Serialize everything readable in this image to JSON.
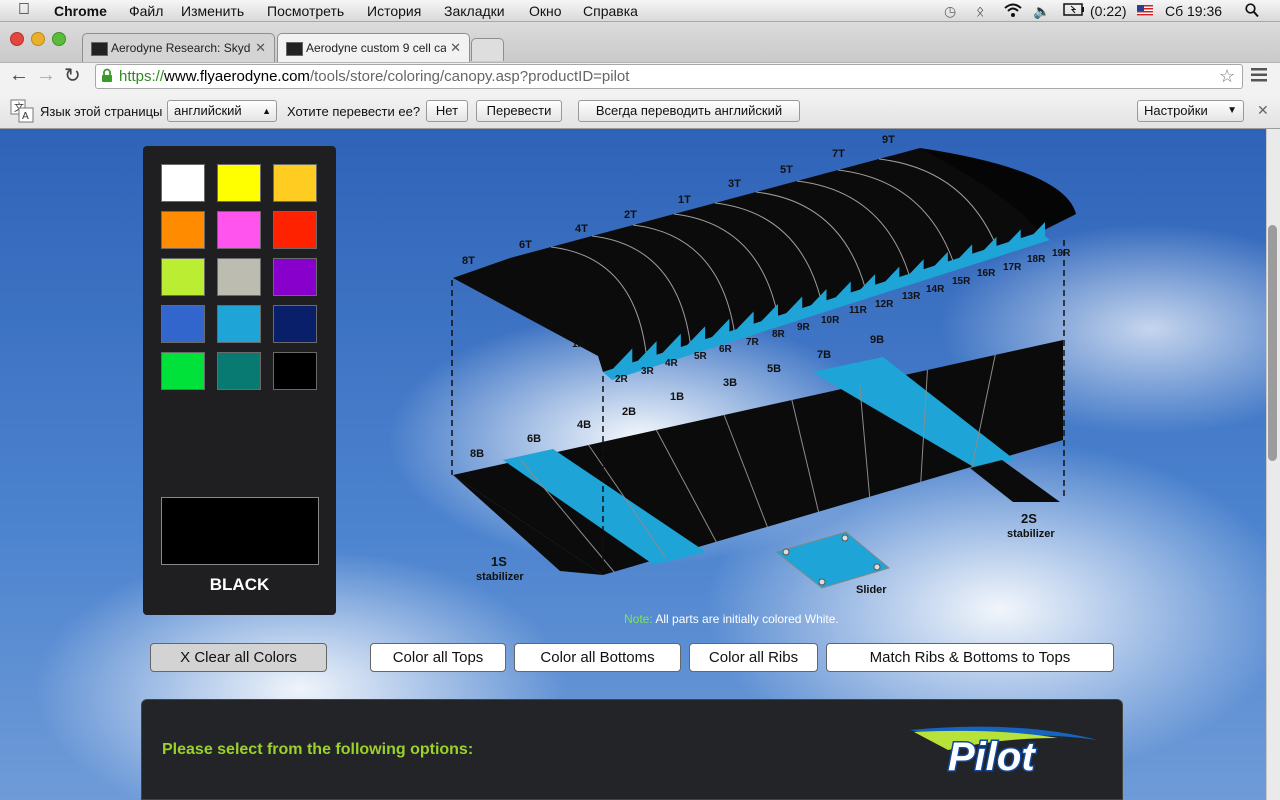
{
  "menubar": {
    "app": "Chrome",
    "items": [
      "Файл",
      "Изменить",
      "Посмотреть",
      "История",
      "Закладки",
      "Окно",
      "Справка"
    ],
    "battery": "(0:22)",
    "clock": "Сб 19:36"
  },
  "tabs": [
    {
      "title": "Aerodyne Research: Skydiv"
    },
    {
      "title": "Aerodyne custom 9 cell ca"
    }
  ],
  "address": {
    "scheme": "https://",
    "host": "www.flyaerodyne.com",
    "path": "/tools/store/coloring/canopy.asp?productID=pilot"
  },
  "translate": {
    "label": "Язык этой страницы",
    "language": "английский",
    "question": "Хотите перевести ее?",
    "no": "Нет",
    "translate": "Перевести",
    "always": "Всегда переводить английский",
    "settings": "Настройки"
  },
  "palette": {
    "colors": [
      "#ffffff",
      "#ffff00",
      "#ffcc22",
      "#ff8c00",
      "#ff55ee",
      "#ff2200",
      "#bbee33",
      "#bcbcb0",
      "#8800cc",
      "#3366cc",
      "#1ea4d6",
      "#0a1f6a",
      "#00e23a",
      "#087a72",
      "#000000"
    ],
    "selected_name": "BLACK",
    "selected_color": "#000000"
  },
  "canopy": {
    "top_labels": [
      "8T",
      "6T",
      "4T",
      "2T",
      "1T",
      "3T",
      "5T",
      "7T",
      "9T"
    ],
    "bottom_labels": [
      "8B",
      "6B",
      "4B",
      "2B",
      "1B",
      "3B",
      "5B",
      "7B",
      "9B"
    ],
    "rib_labels": [
      "1R",
      "2R",
      "3R",
      "4R",
      "5R",
      "6R",
      "7R",
      "8R",
      "9R",
      "10R",
      "11R",
      "12R",
      "13R",
      "14R",
      "15R",
      "16R",
      "17R",
      "18R",
      "19R"
    ],
    "stab_left": "1S",
    "stab_right": "2S",
    "stabilizer": "stabilizer",
    "slider": "Slider",
    "top_color": "#0b0b0b",
    "rib_color": "#1ea4d6"
  },
  "note": {
    "prefix": "Note:",
    "text": "All parts are initially colored White."
  },
  "actions": {
    "clear": "X   Clear all Colors",
    "tops": "Color all Tops",
    "bottoms": "Color all Bottoms",
    "ribs": "Color all Ribs",
    "match": "Match Ribs & Bottoms to Tops"
  },
  "options": {
    "heading": "Please select from the following options:",
    "logo": "Pilot"
  }
}
